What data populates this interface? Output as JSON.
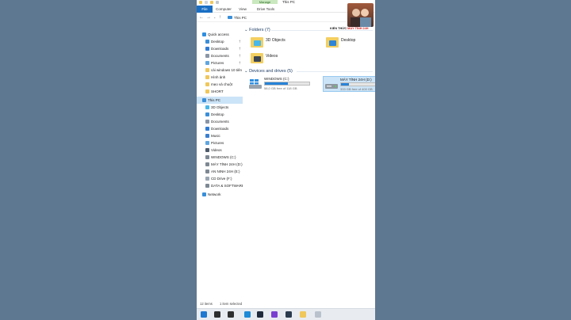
{
  "window": {
    "context_tab": "Manage",
    "title": "This PC"
  },
  "ribbon": {
    "tabs": [
      {
        "label": "File"
      },
      {
        "label": "Computer"
      },
      {
        "label": "View"
      },
      {
        "label": "Drive Tools"
      }
    ]
  },
  "address": {
    "back_icon": "arrow-left-icon",
    "forward_icon": "arrow-right-icon",
    "recent_icon": "chevron-down-icon",
    "up_icon": "arrow-up-icon",
    "path": "This PC"
  },
  "logo": {
    "text_black": "KIẾN THỨC",
    "text_red": "MÁY TÍNH 24H"
  },
  "nav": {
    "items": [
      {
        "label": "Quick access",
        "icon": "star-icon",
        "color": "#2f8ee0",
        "pinned": false,
        "selected": false
      },
      {
        "label": "Desktop",
        "icon": "desktop-icon",
        "color": "#3a8fd8",
        "pinned": true,
        "selected": false
      },
      {
        "label": "Downloads",
        "icon": "download-icon",
        "color": "#2f7bd4",
        "pinned": true,
        "selected": false
      },
      {
        "label": "Documents",
        "icon": "document-icon",
        "color": "#8a96a6",
        "pinned": true,
        "selected": false
      },
      {
        "label": "Pictures",
        "icon": "pictures-icon",
        "color": "#5fa6df",
        "pinned": true,
        "selected": false
      },
      {
        "label": "cài windows 10 tiên",
        "icon": "folder-icon",
        "color": "#f0c75a",
        "pinned": false,
        "selected": false
      },
      {
        "label": "Hình ảnh",
        "icon": "folder-icon",
        "color": "#f0c75a",
        "pinned": false,
        "selected": false
      },
      {
        "label": "mẹo và chuột",
        "icon": "folder-icon",
        "color": "#f0c75a",
        "pinned": false,
        "selected": false
      },
      {
        "label": "SHORT",
        "icon": "folder-icon",
        "color": "#f0c75a",
        "pinned": false,
        "selected": false
      },
      {
        "label": "This PC",
        "icon": "computer-icon",
        "color": "#3a8fd8",
        "pinned": false,
        "selected": true
      },
      {
        "label": "3D Objects",
        "icon": "cube-icon",
        "color": "#49b7e8",
        "pinned": false,
        "selected": false
      },
      {
        "label": "Desktop",
        "icon": "desktop-icon",
        "color": "#3a8fd8",
        "pinned": false,
        "selected": false
      },
      {
        "label": "Documents",
        "icon": "document-icon",
        "color": "#8a96a6",
        "pinned": false,
        "selected": false
      },
      {
        "label": "Downloads",
        "icon": "download-icon",
        "color": "#2f7bd4",
        "pinned": false,
        "selected": false
      },
      {
        "label": "Music",
        "icon": "music-icon",
        "color": "#3a7fcf",
        "pinned": false,
        "selected": false
      },
      {
        "label": "Pictures",
        "icon": "pictures-icon",
        "color": "#5fa6df",
        "pinned": false,
        "selected": false
      },
      {
        "label": "Videos",
        "icon": "videos-icon",
        "color": "#4d5b6b",
        "pinned": false,
        "selected": false
      },
      {
        "label": "WINDOWS (C:)",
        "icon": "drive-icon",
        "color": "#7d8893",
        "pinned": false,
        "selected": false
      },
      {
        "label": "MÁY TÍNH 24H (D:)",
        "icon": "drive-icon",
        "color": "#7d8893",
        "pinned": false,
        "selected": false
      },
      {
        "label": "AN NINH 24H (E:)",
        "icon": "drive-icon",
        "color": "#7d8893",
        "pinned": false,
        "selected": false
      },
      {
        "label": "CD Drive (F:)",
        "icon": "cd-drive-icon",
        "color": "#9aa6b2",
        "pinned": false,
        "selected": false
      },
      {
        "label": "DATA & SOFTWARE",
        "icon": "drive-icon",
        "color": "#7d8893",
        "pinned": false,
        "selected": false
      },
      {
        "label": "Network",
        "icon": "network-icon",
        "color": "#3a8fd8",
        "pinned": false,
        "selected": false
      }
    ]
  },
  "content": {
    "folders_header": "Folders (7)",
    "folders": [
      {
        "label": "3D Objects",
        "icon": "cube-folder-icon",
        "color": "#49b7e8"
      },
      {
        "label": "Desktop",
        "icon": "desktop-folder-icon",
        "color": "#2f86d6"
      },
      {
        "label": "Videos",
        "icon": "videos-folder-icon",
        "color": "#3c4652"
      }
    ],
    "drives_header": "Devices and drives (5)",
    "drives": [
      {
        "name": "WINDOWS (C:)",
        "free": "58,0 GB free of 118 GB",
        "used_fraction": 0.51,
        "bar_color": "#2683d9",
        "selected": false,
        "icon": "windows-drive-icon"
      },
      {
        "name": "MÁY TÍNH 24H (D:)",
        "free": "333 GB free of 400 GB",
        "used_fraction": 0.17,
        "bar_color": "#2683d9",
        "selected": true,
        "icon": "drive-icon"
      }
    ]
  },
  "status": {
    "items": "12 items",
    "selected": "1 item selected"
  },
  "taskbar": {
    "icons": [
      {
        "icon": "windows-start-icon",
        "color": "#1f78d1"
      },
      {
        "icon": "search-icon",
        "color": "#2e2e2e"
      },
      {
        "icon": "task-view-icon",
        "color": "#2e2e2e"
      },
      {
        "icon": "edge-icon",
        "color": "#1f8ad6"
      },
      {
        "icon": "camtasia-icon",
        "color": "#1f2a3c"
      },
      {
        "icon": "headset-icon",
        "color": "#7a3fd0"
      },
      {
        "icon": "terminal-icon",
        "color": "#2b3b4d"
      },
      {
        "icon": "file-explorer-icon",
        "color": "#f0c75a"
      },
      {
        "icon": "cloud-icon",
        "color": "#b9c2cc"
      }
    ]
  }
}
